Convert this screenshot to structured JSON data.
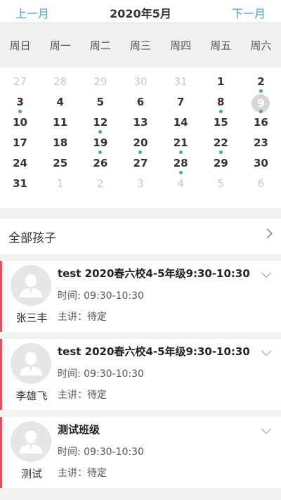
{
  "header": {
    "prev_label": "上一月",
    "title": "2020年5月",
    "next_label": "下一月"
  },
  "weekdays": [
    "周日",
    "周一",
    "周二",
    "周三",
    "周四",
    "周五",
    "周六"
  ],
  "weeks": [
    [
      {
        "d": "27",
        "o": true
      },
      {
        "d": "28",
        "o": true
      },
      {
        "d": "29",
        "o": true
      },
      {
        "d": "30",
        "o": true
      },
      {
        "d": "31",
        "o": true
      },
      {
        "d": "1"
      },
      {
        "d": "2",
        "dot": true
      }
    ],
    [
      {
        "d": "3",
        "dot": true
      },
      {
        "d": "4"
      },
      {
        "d": "5"
      },
      {
        "d": "6"
      },
      {
        "d": "7"
      },
      {
        "d": "8",
        "dot": true
      },
      {
        "d": "9",
        "sel": true,
        "dot": true
      }
    ],
    [
      {
        "d": "10"
      },
      {
        "d": "11"
      },
      {
        "d": "12",
        "dot": true
      },
      {
        "d": "13"
      },
      {
        "d": "14"
      },
      {
        "d": "15"
      },
      {
        "d": "16"
      }
    ],
    [
      {
        "d": "17"
      },
      {
        "d": "18"
      },
      {
        "d": "19",
        "dot": true
      },
      {
        "d": "20",
        "dot": true
      },
      {
        "d": "21",
        "dot": true
      },
      {
        "d": "22",
        "dot": true
      },
      {
        "d": "23"
      }
    ],
    [
      {
        "d": "24"
      },
      {
        "d": "25"
      },
      {
        "d": "26"
      },
      {
        "d": "27"
      },
      {
        "d": "28",
        "dot": true
      },
      {
        "d": "29"
      },
      {
        "d": "30"
      }
    ],
    [
      {
        "d": "31"
      },
      {
        "d": "1",
        "o": true
      },
      {
        "d": "2",
        "o": true
      },
      {
        "d": "3",
        "o": true
      },
      {
        "d": "4",
        "o": true
      },
      {
        "d": "5",
        "o": true
      },
      {
        "d": "6",
        "o": true
      }
    ]
  ],
  "filter": {
    "label": "全部孩子"
  },
  "cards": [
    {
      "name": "张三丰",
      "title": "test 2020春六校4-5年级9:30-10:30",
      "time": "时间: 09:30-10:30",
      "teacher": "主讲：待定"
    },
    {
      "name": "李雄飞",
      "title": "test 2020春六校4-5年级9:30-10:30",
      "time": "时间: 09:30-10:30",
      "teacher": "主讲：待定"
    },
    {
      "name": "测试",
      "title": "测试班级",
      "time": "时间: 09:30-10:30",
      "teacher": "主讲：待定"
    }
  ],
  "colors": {
    "accent": "#4aa3b8",
    "card_border": "#e84f5c"
  }
}
